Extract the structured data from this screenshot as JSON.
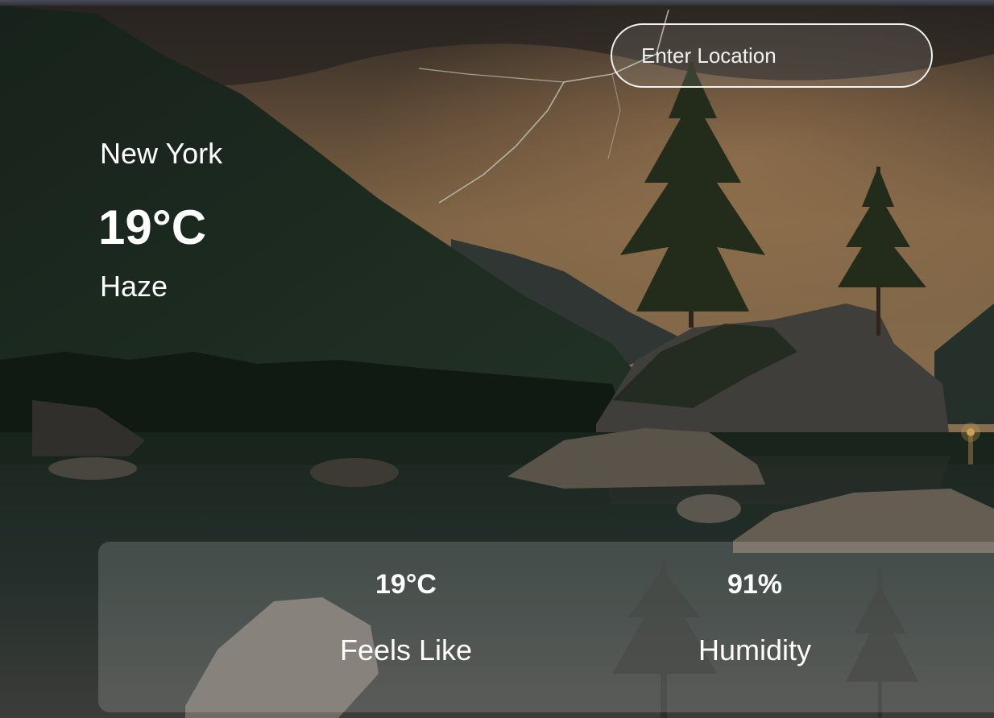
{
  "search": {
    "placeholder": "Enter Location",
    "value": ""
  },
  "weather": {
    "city": "New York",
    "temperature": "19°C",
    "condition": "Haze"
  },
  "details": {
    "feels_like_value": "19°C",
    "feels_like_label": "Feels Like",
    "humidity_value": "91%",
    "humidity_label": "Humidity"
  },
  "background": {
    "description_icon": "landscape-background",
    "sky_color": "#8a6a45",
    "water_color": "#2f3a34",
    "forest_color": "#1f2e1f"
  }
}
